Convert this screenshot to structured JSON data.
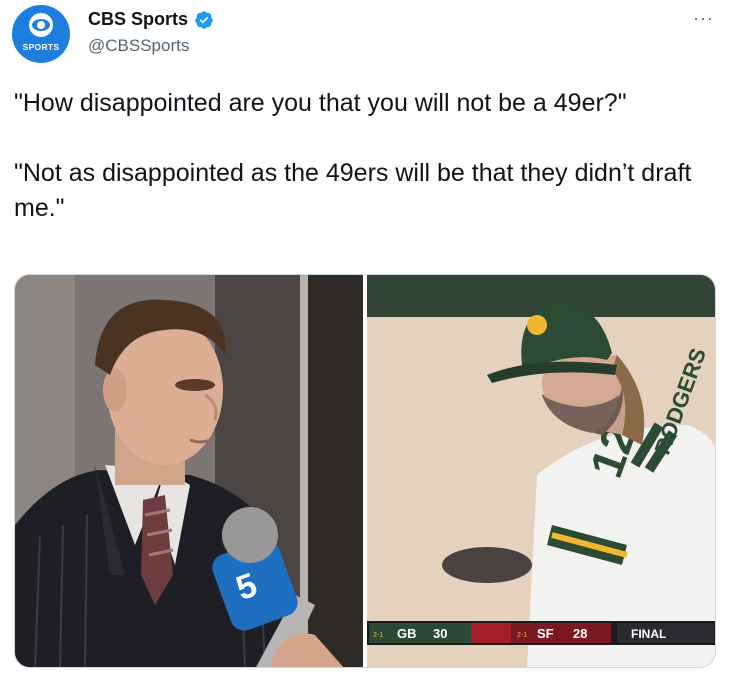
{
  "author": {
    "display_name": "CBS Sports",
    "handle": "@CBSSports",
    "avatar_label": "SPORTS",
    "verified": true,
    "brand_color": "#1d7ee0"
  },
  "tweet": {
    "paragraphs": [
      "\"How disappointed are you that you will not be a 49er?\"",
      "\"Not as disappointed as the 49ers will be that they didn’t draft me.\""
    ]
  },
  "more_label": "···",
  "media": {
    "left": {
      "logo_text": "5"
    },
    "right": {
      "scorebug": {
        "away_record": "2-1",
        "away_team": "GB",
        "away_score": "30",
        "home_record": "2-1",
        "home_team": "SF",
        "home_score": "28",
        "status": "FINAL"
      },
      "jersey_number": "12",
      "jersey_name": "RODGERS"
    }
  },
  "colors": {
    "verified_blue": "#1d9bf0",
    "text": "#0f1419",
    "secondary_text": "#536471"
  }
}
